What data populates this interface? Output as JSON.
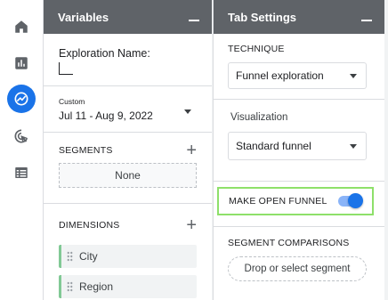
{
  "rail": {
    "items": [
      {
        "icon": "home-icon"
      },
      {
        "icon": "reports-icon"
      },
      {
        "icon": "explore-icon",
        "active": true
      },
      {
        "icon": "advertising-icon"
      },
      {
        "icon": "configure-icon"
      }
    ],
    "accent": "#1a73e8"
  },
  "variables": {
    "title": "Variables",
    "exploration_name_label": "Exploration Name:",
    "date": {
      "tag": "Custom",
      "value": "Jul 11 - Aug 9, 2022"
    },
    "segments": {
      "title": "SEGMENTS",
      "empty": "None"
    },
    "dimensions": {
      "title": "DIMENSIONS",
      "items": [
        "City",
        "Region"
      ]
    }
  },
  "tab_settings": {
    "title": "Tab Settings",
    "technique": {
      "label": "TECHNIQUE",
      "value": "Funnel exploration"
    },
    "visualization": {
      "label": "Visualization",
      "value": "Standard funnel"
    },
    "open_funnel": {
      "label": "MAKE OPEN FUNNEL",
      "enabled": true,
      "highlight": "#8ee06a"
    },
    "segment_comparisons": {
      "label": "SEGMENT COMPARISONS",
      "drop_text": "Drop or select segment"
    }
  }
}
